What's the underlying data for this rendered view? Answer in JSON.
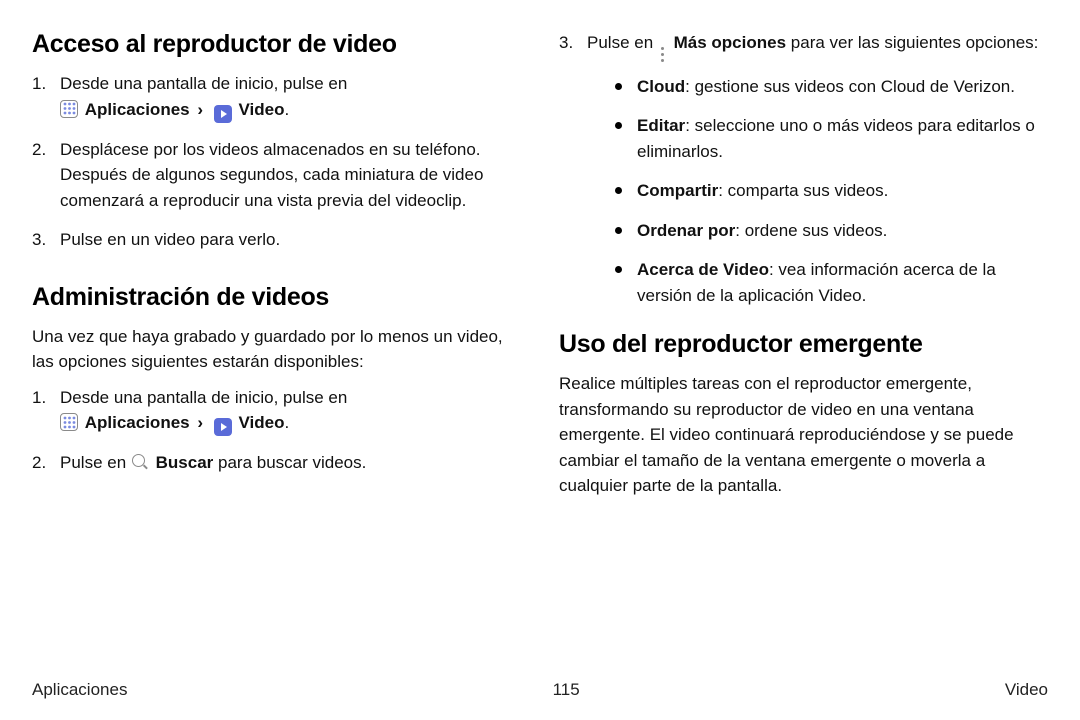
{
  "left": {
    "h1": "Acceso al reproductor de video",
    "s1_li1_a": "Desde una pantalla de inicio, pulse en ",
    "apps_label": "Aplicaciones",
    "video_label": "Video",
    "s1_li2": "Desplácese por los videos almacenados en su teléfono. Después de algunos segundos, cada miniatura de video comenzará a reproducir una vista previa del videoclip.",
    "s1_li3": "Pulse en un video para verlo.",
    "h2": "Administración de videos",
    "p2": "Una vez que haya grabado y guardado por lo menos un video, las opciones siguientes estarán disponibles:",
    "s2_li1_a": "Desde una pantalla de inicio, pulse en ",
    "s2_li2_a": "Pulse en ",
    "search_label": "Buscar",
    "s2_li2_b": " para buscar videos."
  },
  "right": {
    "li3_a": "Pulse en ",
    "more_label": "Más opciones",
    "li3_b": " para ver las siguientes opciones:",
    "bullets": {
      "b1_t": "Cloud",
      "b1_d": ": gestione sus videos con Cloud de Verizon.",
      "b2_t": "Editar",
      "b2_d": ": seleccione uno o más videos para editarlos o eliminarlos.",
      "b3_t": "Compartir",
      "b3_d": ": comparta sus videos.",
      "b4_t": "Ordenar por",
      "b4_d": ": ordene sus videos.",
      "b5_t": "Acerca de Video",
      "b5_d": ": vea información acerca de la versión de la aplicación Video."
    },
    "h3": "Uso del reproductor emergente",
    "p3": "Realice múltiples tareas con el reproductor emergente, transformando su reproductor de video en una ventana emergente. El video continuará reproduciéndose y se puede cambiar el tamaño de la ventana emergente o moverla a cualquier parte de la pantalla."
  },
  "footer": {
    "left": "Aplicaciones",
    "center": "115",
    "right": "Video"
  }
}
